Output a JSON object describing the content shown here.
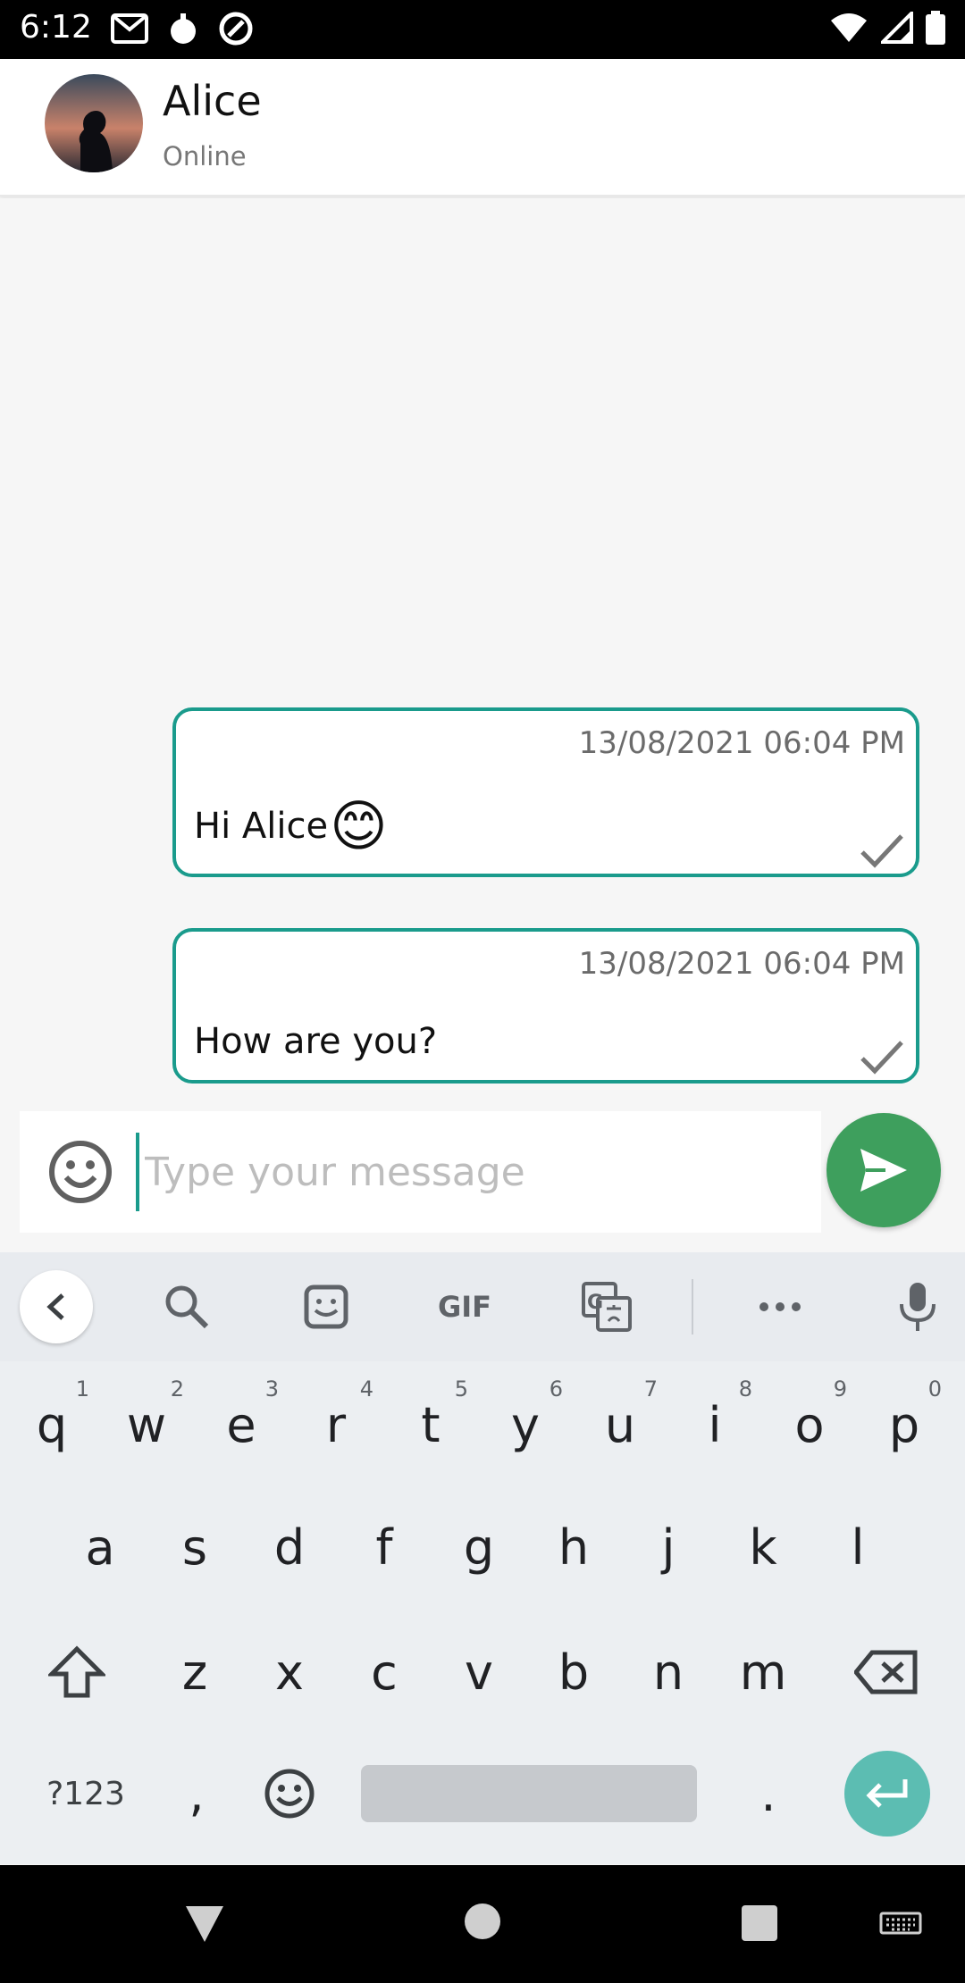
{
  "status_bar": {
    "time": "6:12",
    "left_icons": [
      "gmail-icon",
      "app-icon",
      "sync-icon"
    ],
    "right_icons": [
      "wifi-icon",
      "signal-icon",
      "battery-icon"
    ]
  },
  "header": {
    "contact_name": "Alice",
    "contact_status": "Online"
  },
  "messages": [
    {
      "timestamp": "13/08/2021 06:04 PM",
      "text": "Hi Alice",
      "emoji": "😊",
      "status": "sent"
    },
    {
      "timestamp": "13/08/2021 06:04 PM",
      "text": "How are you?",
      "status": "sent"
    }
  ],
  "composer": {
    "placeholder": "Type your message",
    "value": ""
  },
  "keyboard": {
    "toolbar": [
      "back-icon",
      "search-icon",
      "sticker-icon",
      "GIF",
      "translate-icon",
      "more-icon",
      "mic-icon"
    ],
    "row1": [
      "q",
      "w",
      "e",
      "r",
      "t",
      "y",
      "u",
      "i",
      "o",
      "p"
    ],
    "row1_hints": [
      "1",
      "2",
      "3",
      "4",
      "5",
      "6",
      "7",
      "8",
      "9",
      "0"
    ],
    "row2": [
      "a",
      "s",
      "d",
      "f",
      "g",
      "h",
      "j",
      "k",
      "l"
    ],
    "row3": [
      "z",
      "x",
      "c",
      "v",
      "b",
      "n",
      "m"
    ],
    "symbols_key": "?123",
    "comma_key": ",",
    "period_key": "."
  },
  "colors": {
    "accent": "#1a9b8c",
    "send_button": "#3e9f5d",
    "enter_key": "#5cbdb2"
  }
}
